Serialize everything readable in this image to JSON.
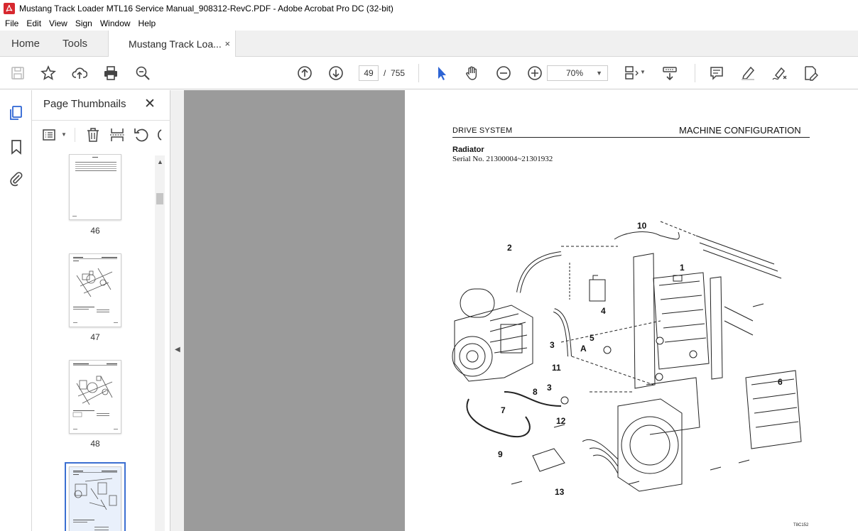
{
  "window": {
    "title": "Mustang Track Loader MTL16 Service Manual_908312-RevC.PDF - Adobe Acrobat Pro DC (32-bit)"
  },
  "menu": [
    "File",
    "Edit",
    "View",
    "Sign",
    "Window",
    "Help"
  ],
  "tabs": {
    "home": "Home",
    "tools": "Tools",
    "document": "Mustang Track Loa...",
    "close": "×"
  },
  "toolbar": {
    "current_page": "49",
    "page_separator": "/",
    "total_pages": "755",
    "zoom": "70%"
  },
  "panel": {
    "title": "Page Thumbnails",
    "close": "✕",
    "thumbnails": [
      {
        "label": "46"
      },
      {
        "label": "47"
      },
      {
        "label": "48"
      },
      {
        "label": ""
      }
    ]
  },
  "document_page": {
    "header_left": "DRIVE SYSTEM",
    "header_right": "MACHINE CONFIGURATION",
    "section_title": "Radiator",
    "serial": "Serial No. 21300004~21301932",
    "figure_code": "T8C152",
    "callouts": [
      "1",
      "2",
      "3",
      "3",
      "4",
      "5",
      "6",
      "7",
      "8",
      "9",
      "10",
      "11",
      "12",
      "13",
      "A"
    ]
  },
  "colors": {
    "accent": "#3b6fd1",
    "canvas": "#9b9b9b",
    "app_red": "#d7282f"
  }
}
